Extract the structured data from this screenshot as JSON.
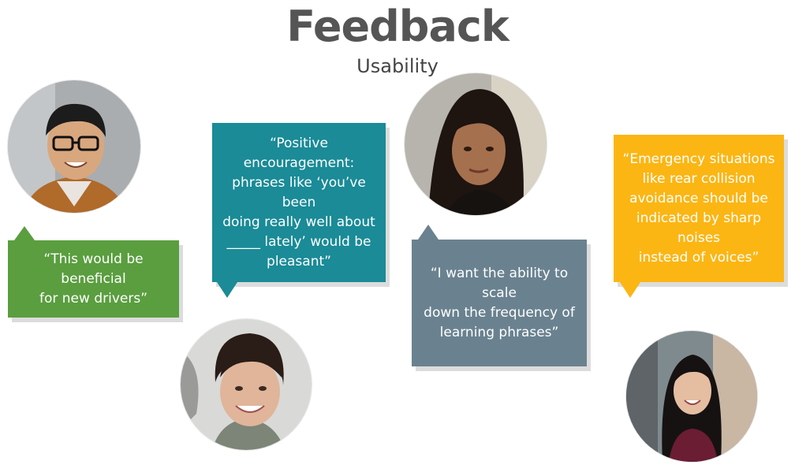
{
  "header": {
    "title": "Feedback",
    "subtitle": "Usability"
  },
  "feedback": [
    {
      "quote": "“This would be beneficial\nfor new drivers”",
      "color": "#5a9e3f"
    },
    {
      "quote": "“Positive encouragement:\nphrases like ‘you’ve been\ndoing really well about\n_____ lately’ would be\npleasant”",
      "color": "#1a8b97"
    },
    {
      "quote": "“I want the ability to scale\ndown the frequency of\nlearning phrases”",
      "color": "#6a8290"
    },
    {
      "quote": "“Emergency situations\nlike rear collision\navoidance should be\nindicated by sharp noises\ninstead of voices”",
      "color": "#fbb614"
    }
  ]
}
